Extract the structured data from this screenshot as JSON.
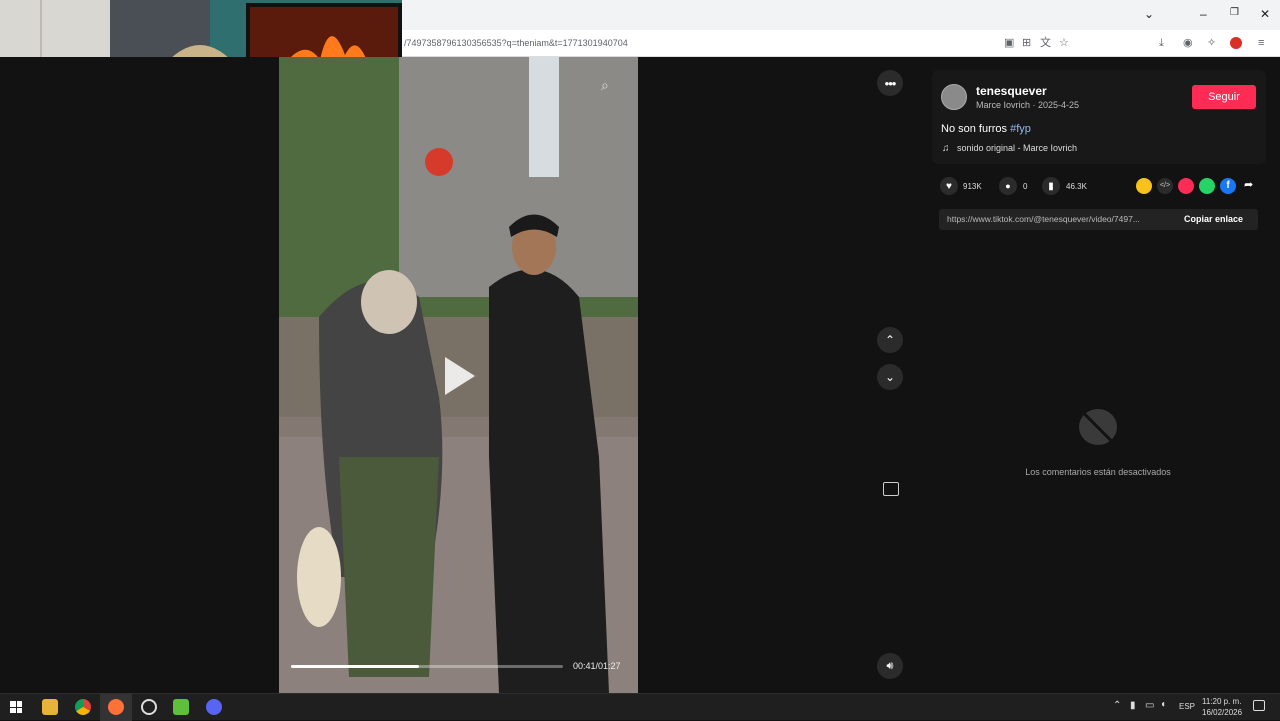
{
  "browser": {
    "url": "/7497358796130356535?q=theniam&t=1771301940704"
  },
  "video": {
    "time": "00:41/01:27",
    "progress": 0.47
  },
  "author": {
    "username": "tenesquever",
    "display_line": "Marce Iovrich · 2025-4-25",
    "follow_label": "Seguir"
  },
  "post": {
    "caption": "No son furros ",
    "hashtag": "#fyp",
    "sound": "sonido original - Marce Iovrich"
  },
  "stats": {
    "likes": "913K",
    "comments": "0",
    "saves": "46.3K"
  },
  "link": {
    "url": "https://www.tiktok.com/@tenesquever/video/7497...",
    "copy_label": "Copiar enlace"
  },
  "comments": {
    "disabled_text": "Los comentarios están desactivados"
  },
  "taskbar": {
    "language": "ESP",
    "time": "11:20 p. m.",
    "date": "16/02/2026"
  },
  "colors": {
    "accent": "#fe2c55",
    "hashtag": "#8fb8f0"
  }
}
